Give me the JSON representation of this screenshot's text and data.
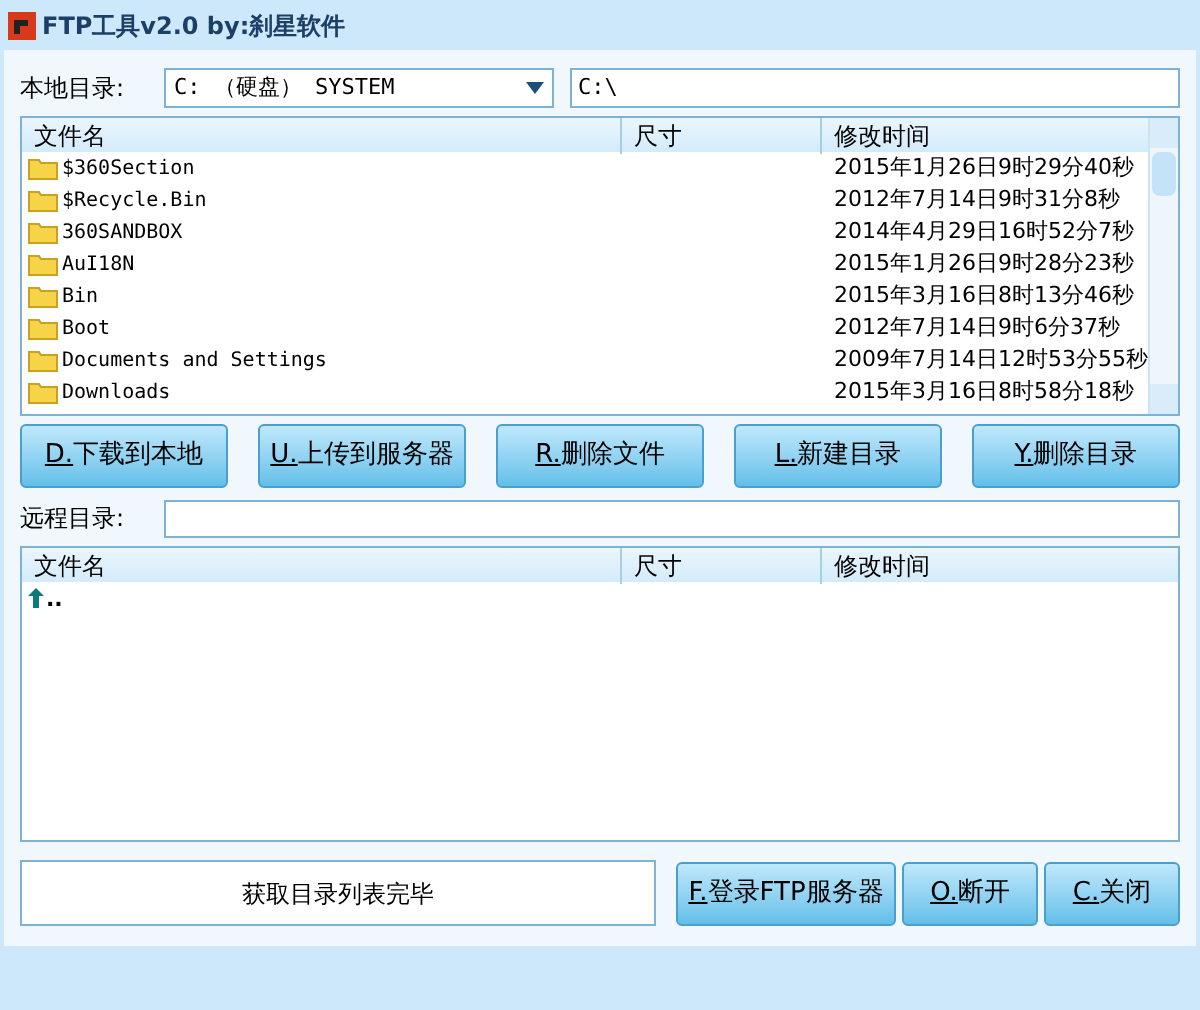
{
  "window": {
    "title": "FTP工具v2.0  by:刹星软件"
  },
  "local": {
    "label": "本地目录:",
    "drive": "C: （硬盘） SYSTEM",
    "path": "C:\\"
  },
  "local_table": {
    "columns": [
      "文件名",
      "尺寸",
      "修改时间"
    ],
    "rows": [
      {
        "name": "$360Section",
        "size": "",
        "modified": "2015年1月26日9时29分40秒"
      },
      {
        "name": "$Recycle.Bin",
        "size": "",
        "modified": "2012年7月14日9时31分8秒"
      },
      {
        "name": "360SANDBOX",
        "size": "",
        "modified": "2014年4月29日16时52分7秒"
      },
      {
        "name": "AuI18N",
        "size": "",
        "modified": "2015年1月26日9时28分23秒"
      },
      {
        "name": "Bin",
        "size": "",
        "modified": "2015年3月16日8时13分46秒"
      },
      {
        "name": "Boot",
        "size": "",
        "modified": "2012年7月14日9时6分37秒"
      },
      {
        "name": "Documents and Settings",
        "size": "",
        "modified": "2009年7月14日12时53分55秒"
      },
      {
        "name": "Downloads",
        "size": "",
        "modified": "2015年3月16日8时58分18秒"
      }
    ]
  },
  "actions": [
    {
      "key": "D.",
      "label": "下载到本地"
    },
    {
      "key": "U.",
      "label": "上传到服务器"
    },
    {
      "key": "R.",
      "label": "删除文件"
    },
    {
      "key": "L.",
      "label": "新建目录"
    },
    {
      "key": "Y.",
      "label": "删除目录"
    }
  ],
  "remote": {
    "label": "远程目录:"
  },
  "remote_table": {
    "columns": [
      "文件名",
      "尺寸",
      "修改时间"
    ],
    "rows": [
      {
        "name": ".."
      }
    ]
  },
  "status": "获取目录列表完毕",
  "buttons": [
    {
      "key": "F.",
      "label": "登录FTP服务器"
    },
    {
      "key": "O.",
      "label": "断开"
    },
    {
      "key": "C.",
      "label": "关闭"
    }
  ]
}
